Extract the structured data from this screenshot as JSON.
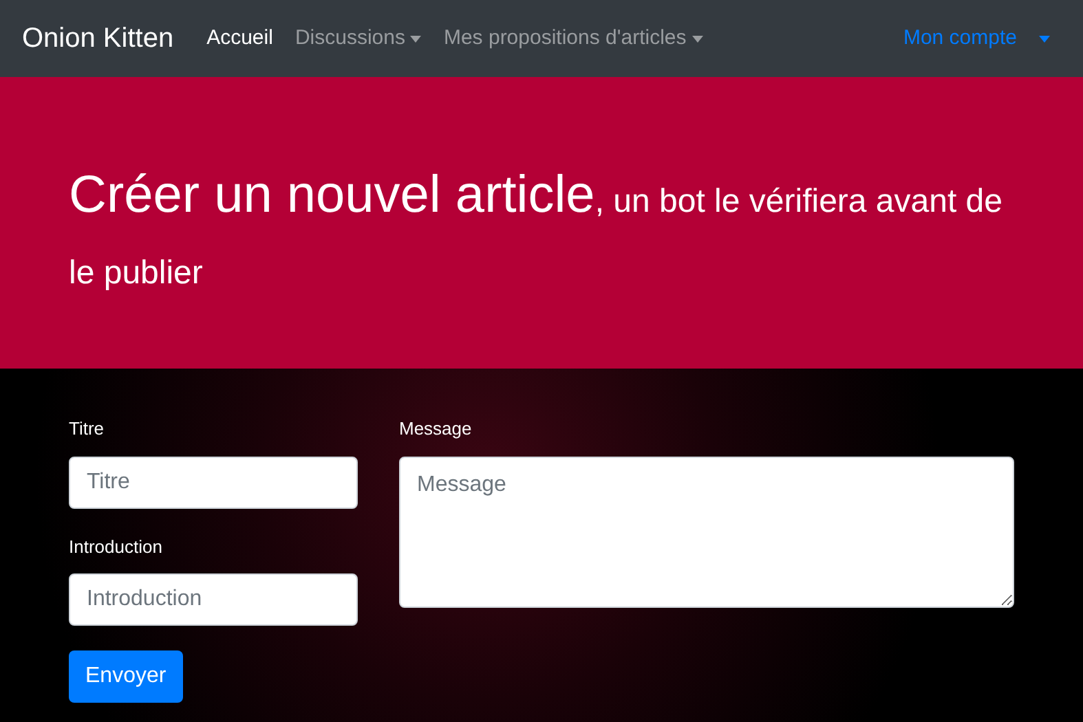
{
  "navbar": {
    "brand": "Onion Kitten",
    "items": [
      {
        "label": "Accueil",
        "selected": true,
        "dropdown": false
      },
      {
        "label": "Discussions",
        "selected": false,
        "dropdown": true
      },
      {
        "label": "Mes propositions d'articles",
        "selected": false,
        "dropdown": true
      }
    ],
    "account": {
      "label": "Mon compte",
      "dropdown": true
    }
  },
  "hero": {
    "title": "Créer un nouvel article",
    "subtitle": ", un bot le vérifiera avant de le publier"
  },
  "form": {
    "fields": [
      {
        "label": "Titre",
        "placeholder": "Titre"
      },
      {
        "label": "Introduction",
        "placeholder": "Introduction"
      }
    ],
    "message": {
      "label": "Message",
      "placeholder": "Message"
    },
    "submit": "Envoyer"
  }
}
